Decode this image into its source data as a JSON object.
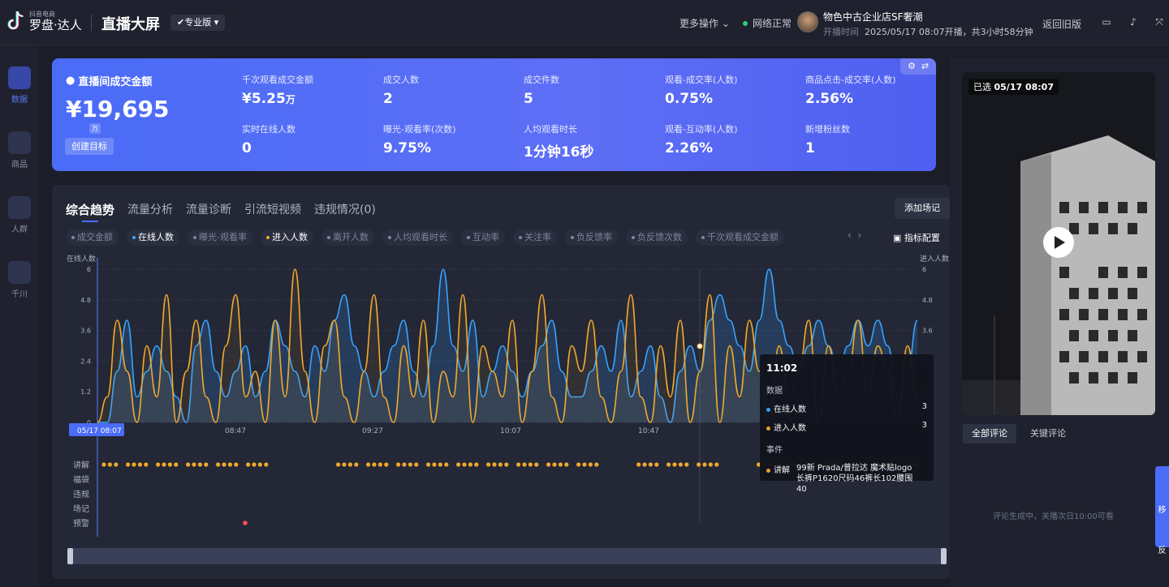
{
  "app": {
    "logo_small": "抖音电商",
    "logo_big": "罗盘·达人",
    "page_title": "直播大屏",
    "edition": "专业版",
    "more_ops": "更多操作",
    "network": "网络正常",
    "shop_name": "物色中古企业店SF奢潮",
    "live_label": "开播时间",
    "live_info": "2025/05/17 08:07开播，共3小时58分钟",
    "back": "返回旧版"
  },
  "sidebar": [
    {
      "label": "数据",
      "icon": "chart-icon"
    },
    {
      "label": "商品",
      "icon": "cart-icon"
    },
    {
      "label": "人群",
      "icon": "people-icon"
    },
    {
      "label": "千川",
      "icon": "ad-icon"
    }
  ],
  "kpi": {
    "main_title": "直播间成交金额",
    "main_value": "¥19,695",
    "main_unit": "万",
    "create_target": "创建目标",
    "cells": [
      {
        "label": "千次观看成交金额",
        "value": "¥5.25",
        "unit": "万"
      },
      {
        "label": "成交人数",
        "value": "2",
        "unit": ""
      },
      {
        "label": "成交件数",
        "value": "5",
        "unit": ""
      },
      {
        "label": "观看-成交率(人数)",
        "value": "0.75%",
        "unit": ""
      },
      {
        "label": "商品点击-成交率(人数)",
        "value": "2.56%",
        "unit": ""
      },
      {
        "label": "实时在线人数",
        "value": "0",
        "unit": ""
      },
      {
        "label": "曝光-观看率(次数)",
        "value": "9.75%",
        "unit": ""
      },
      {
        "label": "人均观看时长",
        "value": "1分钟16秒",
        "unit": ""
      },
      {
        "label": "观看-互动率(人数)",
        "value": "2.26%",
        "unit": ""
      },
      {
        "label": "新增粉丝数",
        "value": "1",
        "unit": ""
      }
    ]
  },
  "trend": {
    "tabs": [
      "综合趋势",
      "流量分析",
      "流量诊断",
      "引流短视频",
      "违规情况(0)"
    ],
    "add_marker": "添加场记",
    "indicator_config": "指标配置",
    "chips": [
      {
        "label": "成交金额",
        "state": "off"
      },
      {
        "label": "在线人数",
        "state": "blue"
      },
      {
        "label": "曝光-观看率",
        "state": "off"
      },
      {
        "label": "进入人数",
        "state": "yellow"
      },
      {
        "label": "离开人数",
        "state": "off"
      },
      {
        "label": "人均观看时长",
        "state": "off"
      },
      {
        "label": "互动率",
        "state": "off"
      },
      {
        "label": "关注率",
        "state": "off"
      },
      {
        "label": "负反馈率",
        "state": "off"
      },
      {
        "label": "负反馈次数",
        "state": "off"
      },
      {
        "label": "千次观看成交金额",
        "state": "off"
      }
    ]
  },
  "chart_data": {
    "type": "line",
    "left_axis_label": "在线人数",
    "right_axis_label": "进入人数",
    "y_ticks": [
      "0",
      "1.2",
      "2.4",
      "3.6",
      "4.8",
      "6"
    ],
    "ylim": [
      0,
      6
    ],
    "x_ticks": [
      "05/17 08:07",
      "08:47",
      "09:27",
      "10:07",
      "10:47"
    ],
    "series": [
      {
        "name": "在线人数",
        "color": "#36a3ff",
        "values": [
          0,
          0,
          2,
          4,
          1,
          2,
          3,
          2,
          1,
          0,
          3,
          4,
          2,
          1,
          2,
          3,
          1,
          2,
          4,
          3,
          2,
          1,
          3,
          2,
          4,
          5,
          3,
          2,
          1,
          2,
          3,
          4,
          2,
          1,
          3,
          6,
          3,
          2,
          4,
          1,
          2,
          3,
          2,
          1,
          2,
          3,
          4,
          2,
          1,
          1,
          2,
          3,
          2,
          4,
          1,
          2,
          3,
          1,
          0,
          2,
          3,
          2,
          4,
          5,
          4,
          3,
          2,
          4,
          6,
          4,
          3,
          2,
          3,
          4,
          3,
          2,
          3,
          4,
          3,
          4,
          3,
          1,
          2,
          4
        ]
      },
      {
        "name": "进入人数",
        "color": "#f0a82c",
        "values": [
          0,
          1,
          4,
          2,
          0,
          3,
          1,
          5,
          0,
          2,
          4,
          1,
          0,
          3,
          5,
          1,
          2,
          0,
          4,
          1,
          6,
          2,
          0,
          3,
          4,
          1,
          0,
          2,
          5,
          1,
          0,
          3,
          1,
          4,
          0,
          2,
          1,
          5,
          0,
          3,
          2,
          1,
          4,
          0,
          2,
          5,
          1,
          0,
          3,
          2,
          4,
          1,
          0,
          2,
          5,
          1,
          0,
          3,
          1,
          4,
          0,
          2,
          5,
          0,
          3,
          1,
          4,
          2,
          0,
          3,
          1,
          2,
          4,
          0,
          3,
          1,
          2,
          4,
          1,
          3,
          2,
          0,
          3,
          1
        ]
      }
    ],
    "event_rows": [
      "讲解",
      "福袋",
      "违规",
      "场记",
      "预警"
    ]
  },
  "tooltip": {
    "time": "11:02",
    "data_title": "数据",
    "rows": [
      {
        "label": "在线人数",
        "value": "3",
        "color": "#36a3ff"
      },
      {
        "label": "进入人数",
        "value": "3",
        "color": "#f0a82c"
      }
    ],
    "event_title": "事件",
    "event_type": "讲解",
    "event_desc": "99新 Prada/普拉达 魔术贴logo长裤P1620尺码46裤长102腰围40"
  },
  "video": {
    "badge_prefix": "已选",
    "badge_time": "05/17 08:07"
  },
  "comments": {
    "tabs": [
      "全部评论",
      "关键评论"
    ],
    "empty": "评论生成中，关播次日10:00可看"
  },
  "float_tool": {
    "top": "移",
    "bottom": "反"
  }
}
